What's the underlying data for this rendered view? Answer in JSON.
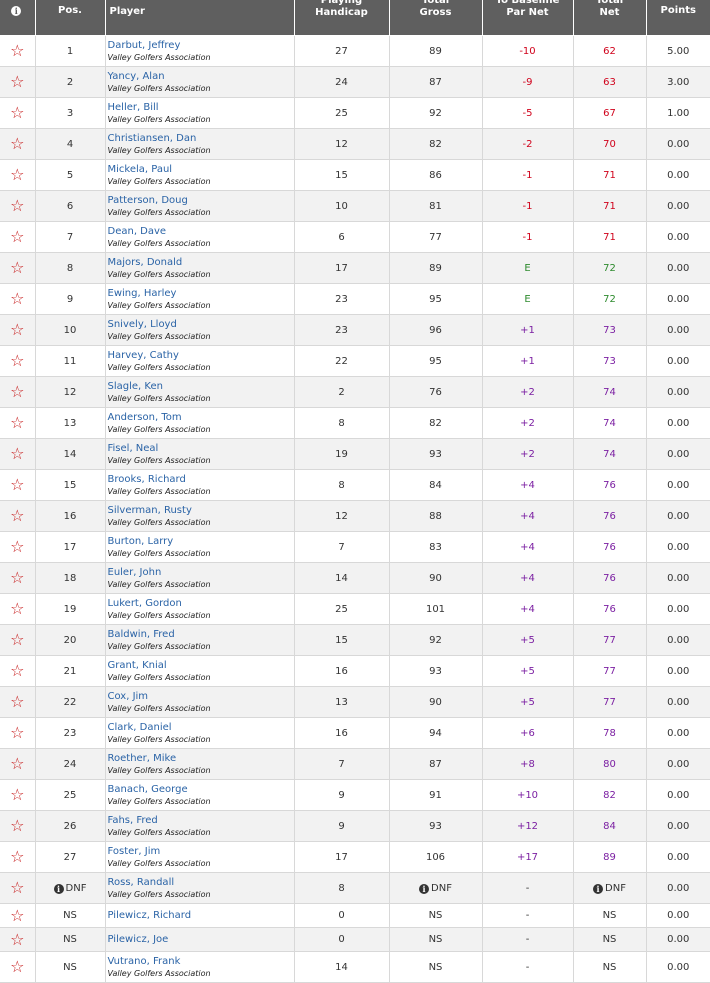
{
  "header": {
    "info": "i",
    "pos": "Pos.",
    "player": "Player",
    "handicap": "Playing\nHandicap",
    "gross": "Total\nGross",
    "baseline": "To Baseline\nPar Net",
    "net": "Total\nNet",
    "points": "Points"
  },
  "rows": [
    {
      "pos": "1",
      "name": "Darbut, Jeffrey",
      "assoc": "Valley Golfers Association",
      "hcp": "27",
      "gross": "89",
      "par": "-10",
      "par_color": "red",
      "net": "62",
      "points": "5.00"
    },
    {
      "pos": "2",
      "name": "Yancy, Alan",
      "assoc": "Valley Golfers Association",
      "hcp": "24",
      "gross": "87",
      "par": "-9",
      "par_color": "red",
      "net": "63",
      "points": "3.00"
    },
    {
      "pos": "3",
      "name": "Heller, Bill",
      "assoc": "Valley Golfers Association",
      "hcp": "25",
      "gross": "92",
      "par": "-5",
      "par_color": "red",
      "net": "67",
      "points": "1.00"
    },
    {
      "pos": "4",
      "name": "Christiansen, Dan",
      "assoc": "Valley Golfers Association",
      "hcp": "12",
      "gross": "82",
      "par": "-2",
      "par_color": "red",
      "net": "70",
      "points": "0.00"
    },
    {
      "pos": "5",
      "name": "Mickela, Paul",
      "assoc": "Valley Golfers Association",
      "hcp": "15",
      "gross": "86",
      "par": "-1",
      "par_color": "red",
      "net": "71",
      "points": "0.00"
    },
    {
      "pos": "6",
      "name": "Patterson, Doug",
      "assoc": "Valley Golfers Association",
      "hcp": "10",
      "gross": "81",
      "par": "-1",
      "par_color": "red",
      "net": "71",
      "points": "0.00"
    },
    {
      "pos": "7",
      "name": "Dean, Dave",
      "assoc": "Valley Golfers Association",
      "hcp": "6",
      "gross": "77",
      "par": "-1",
      "par_color": "red",
      "net": "71",
      "points": "0.00"
    },
    {
      "pos": "8",
      "name": "Majors, Donald",
      "assoc": "Valley Golfers Association",
      "hcp": "17",
      "gross": "89",
      "par": "E",
      "par_color": "green",
      "net": "72",
      "points": "0.00"
    },
    {
      "pos": "9",
      "name": "Ewing, Harley",
      "assoc": "Valley Golfers Association",
      "hcp": "23",
      "gross": "95",
      "par": "E",
      "par_color": "green",
      "net": "72",
      "points": "0.00"
    },
    {
      "pos": "10",
      "name": "Snively, Lloyd",
      "assoc": "Valley Golfers Association",
      "hcp": "23",
      "gross": "96",
      "par": "+1",
      "par_color": "purple",
      "net": "73",
      "points": "0.00"
    },
    {
      "pos": "11",
      "name": "Harvey, Cathy",
      "assoc": "Valley Golfers Association",
      "hcp": "22",
      "gross": "95",
      "par": "+1",
      "par_color": "purple",
      "net": "73",
      "points": "0.00"
    },
    {
      "pos": "12",
      "name": "Slagle, Ken",
      "assoc": "Valley Golfers Association",
      "hcp": "2",
      "gross": "76",
      "par": "+2",
      "par_color": "purple",
      "net": "74",
      "points": "0.00"
    },
    {
      "pos": "13",
      "name": "Anderson, Tom",
      "assoc": "Valley Golfers Association",
      "hcp": "8",
      "gross": "82",
      "par": "+2",
      "par_color": "purple",
      "net": "74",
      "points": "0.00"
    },
    {
      "pos": "14",
      "name": "Fisel, Neal",
      "assoc": "Valley Golfers Association",
      "hcp": "19",
      "gross": "93",
      "par": "+2",
      "par_color": "purple",
      "net": "74",
      "points": "0.00"
    },
    {
      "pos": "15",
      "name": "Brooks, Richard",
      "assoc": "Valley Golfers Association",
      "hcp": "8",
      "gross": "84",
      "par": "+4",
      "par_color": "purple",
      "net": "76",
      "points": "0.00"
    },
    {
      "pos": "16",
      "name": "Silverman, Rusty",
      "assoc": "Valley Golfers Association",
      "hcp": "12",
      "gross": "88",
      "par": "+4",
      "par_color": "purple",
      "net": "76",
      "points": "0.00"
    },
    {
      "pos": "17",
      "name": "Burton, Larry",
      "assoc": "Valley Golfers Association",
      "hcp": "7",
      "gross": "83",
      "par": "+4",
      "par_color": "purple",
      "net": "76",
      "points": "0.00"
    },
    {
      "pos": "18",
      "name": "Euler, John",
      "assoc": "Valley Golfers Association",
      "hcp": "14",
      "gross": "90",
      "par": "+4",
      "par_color": "purple",
      "net": "76",
      "points": "0.00"
    },
    {
      "pos": "19",
      "name": "Lukert, Gordon",
      "assoc": "Valley Golfers Association",
      "hcp": "25",
      "gross": "101",
      "par": "+4",
      "par_color": "purple",
      "net": "76",
      "points": "0.00"
    },
    {
      "pos": "20",
      "name": "Baldwin, Fred",
      "assoc": "Valley Golfers Association",
      "hcp": "15",
      "gross": "92",
      "par": "+5",
      "par_color": "purple",
      "net": "77",
      "points": "0.00"
    },
    {
      "pos": "21",
      "name": "Grant, Knial",
      "assoc": "Valley Golfers Association",
      "hcp": "16",
      "gross": "93",
      "par": "+5",
      "par_color": "purple",
      "net": "77",
      "points": "0.00"
    },
    {
      "pos": "22",
      "name": "Cox, Jim",
      "assoc": "Valley Golfers Association",
      "hcp": "13",
      "gross": "90",
      "par": "+5",
      "par_color": "purple",
      "net": "77",
      "points": "0.00"
    },
    {
      "pos": "23",
      "name": "Clark, Daniel",
      "assoc": "Valley Golfers Association",
      "hcp": "16",
      "gross": "94",
      "par": "+6",
      "par_color": "purple",
      "net": "78",
      "points": "0.00"
    },
    {
      "pos": "24",
      "name": "Roether, Mike",
      "assoc": "Valley Golfers Association",
      "hcp": "7",
      "gross": "87",
      "par": "+8",
      "par_color": "purple",
      "net": "80",
      "points": "0.00"
    },
    {
      "pos": "25",
      "name": "Banach, George",
      "assoc": "Valley Golfers Association",
      "hcp": "9",
      "gross": "91",
      "par": "+10",
      "par_color": "purple",
      "net": "82",
      "points": "0.00"
    },
    {
      "pos": "26",
      "name": "Fahs, Fred",
      "assoc": "Valley Golfers Association",
      "hcp": "9",
      "gross": "93",
      "par": "+12",
      "par_color": "purple",
      "net": "84",
      "points": "0.00"
    },
    {
      "pos": "27",
      "name": "Foster, Jim",
      "assoc": "Valley Golfers Association",
      "hcp": "17",
      "gross": "106",
      "par": "+17",
      "par_color": "purple",
      "net": "89",
      "points": "0.00"
    },
    {
      "pos": "DNF",
      "pos_info": true,
      "name": "Ross, Randall",
      "assoc": "Valley Golfers Association",
      "hcp": "8",
      "gross": "DNF",
      "gross_info": true,
      "par": "-",
      "par_color": "none",
      "net": "DNF",
      "net_info": true,
      "points": "0.00"
    },
    {
      "pos": "NS",
      "name": "Pilewicz, Richard",
      "assoc": "",
      "hcp": "0",
      "gross": "NS",
      "par": "-",
      "par_color": "none",
      "net": "NS",
      "points": "0.00"
    },
    {
      "pos": "NS",
      "name": "Pilewicz, Joe",
      "assoc": "",
      "hcp": "0",
      "gross": "NS",
      "par": "-",
      "par_color": "none",
      "net": "NS",
      "points": "0.00"
    },
    {
      "pos": "NS",
      "name": "Vutrano, Frank",
      "assoc": "Valley Golfers Association",
      "hcp": "14",
      "gross": "NS",
      "par": "-",
      "par_color": "none",
      "net": "NS",
      "points": "0.00"
    }
  ],
  "colors": {
    "header_bg": "#5f5f5f",
    "star": "#c81e1e",
    "link": "#2a63a6",
    "under_par": "#d0021b",
    "even_par": "#2e8b2e",
    "over_par": "#7b1fa2"
  },
  "icons": {
    "favorite": "star-outline-icon",
    "info": "info-circle-icon"
  }
}
